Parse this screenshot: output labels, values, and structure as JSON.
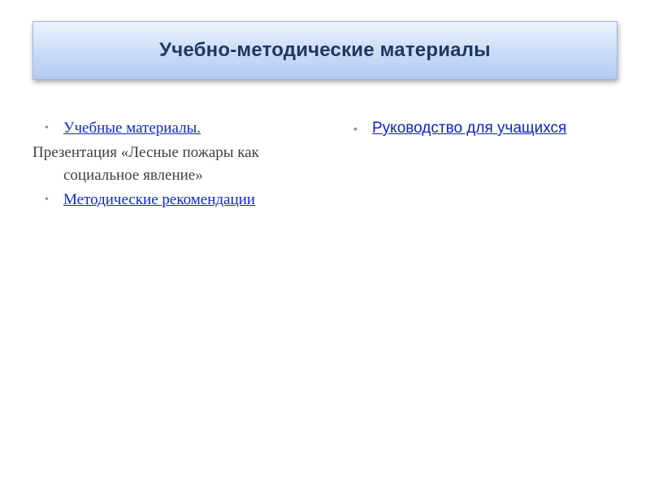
{
  "slide": {
    "title": "Учебно-методические материалы"
  },
  "left_column": {
    "item1_link": "Учебные материалы.",
    "paragraph": "Презентация «Лесные пожары как социальное явление»",
    "item2_link": "Методические рекомендации"
  },
  "right_column": {
    "item1_link": "Руководство для учащихся"
  },
  "icons": {
    "bullet": "•"
  },
  "colors": {
    "title_text": "#1f3763",
    "title_gradient_top": "#eef4fe",
    "title_gradient_bottom": "#b4ccf2",
    "link": "#0d27d6",
    "body_text": "#404040",
    "bullet": "#8a8a8a"
  }
}
